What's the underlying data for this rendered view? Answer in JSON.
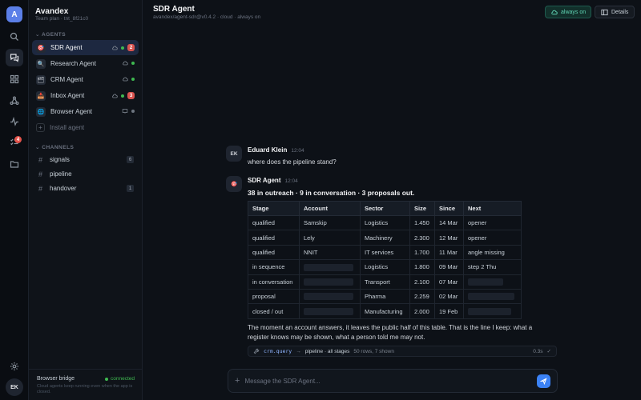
{
  "workspace": {
    "initial": "A",
    "name": "Avandex",
    "plan": "Team plan · tnt_8f21c0"
  },
  "rail": {
    "notification_count": "4",
    "user_initials": "EK"
  },
  "sidebar": {
    "agents_title": "AGENTS",
    "agents": [
      {
        "label": "SDR Agent",
        "icon": "dart-icon",
        "glyph": "🎯",
        "status": "green",
        "badge": "2",
        "host": "cloud"
      },
      {
        "label": "Research Agent",
        "icon": "magnifier-icon",
        "glyph": "🔍",
        "status": "green",
        "badge": "",
        "host": "cloud"
      },
      {
        "label": "CRM Agent",
        "icon": "card-file-icon",
        "glyph": "🗂",
        "status": "green",
        "badge": "",
        "host": "cloud"
      },
      {
        "label": "Inbox Agent",
        "icon": "inbox-icon",
        "glyph": "📥",
        "status": "green",
        "badge": "3",
        "host": "cloud"
      },
      {
        "label": "Browser Agent",
        "icon": "globe-icon",
        "glyph": "🌐",
        "status": "gray",
        "badge": "",
        "host": "monitor"
      }
    ],
    "install_label": "Install agent",
    "channels_title": "CHANNELS",
    "channels": [
      {
        "label": "signals",
        "count": "6"
      },
      {
        "label": "pipeline",
        "count": ""
      },
      {
        "label": "handover",
        "count": "1"
      }
    ],
    "bridge": {
      "title": "Browser bridge",
      "status": "connected",
      "description": "Cloud agents keep running even when the app is closed."
    }
  },
  "header": {
    "title": "SDR Agent",
    "subtitle": "avandex/agent-sdr@v0.4.2 · cloud · always on",
    "always_on_label": "always on",
    "details_label": "Details"
  },
  "messages": {
    "user": {
      "initials": "EK",
      "name": "Eduard Klein",
      "time": "12:04",
      "text": "where does the pipeline stand?"
    },
    "agent": {
      "name": "SDR Agent",
      "time": "12:04",
      "summary": "38 in outreach · 9 in conversation · 3 proposals out.",
      "table": {
        "headers": [
          "Stage",
          "Account",
          "Sector",
          "Size",
          "Since",
          "Next"
        ],
        "rows": [
          [
            "qualified",
            "Samskip",
            "Logistics",
            "1.450",
            "14 Mar",
            "opener"
          ],
          [
            "qualified",
            "Lely",
            "Machinery",
            "2.300",
            "12 Mar",
            "opener"
          ],
          [
            "qualified",
            "NNIT",
            "IT services",
            "1.700",
            "11 Mar",
            "angle missing"
          ],
          [
            "in sequence",
            "",
            "Logistics",
            "1.800",
            "09 Mar",
            "step 2 Thu"
          ],
          [
            "in conversation",
            "",
            "Transport",
            "2.100",
            "07 Mar",
            ""
          ],
          [
            "proposal",
            "",
            "Pharma",
            "2.259",
            "02 Mar",
            ""
          ],
          [
            "closed / out",
            "",
            "Manufacturing",
            "2.000",
            "19 Feb",
            ""
          ]
        ]
      },
      "footer_text": "The moment an account answers, it leaves the public half of this table. That is the line I keep: what a register knows may be shown, what a person told me may not.",
      "tool_call": {
        "name": "crm.query",
        "arrow": "→",
        "target": "pipeline · all stages",
        "result": "50 rows, 7 shown",
        "duration": "0.3s"
      }
    }
  },
  "composer": {
    "placeholder": "Message the SDR Agent..."
  },
  "colors": {
    "accent": "#3b82f6",
    "active_bg": "#1d2840",
    "status_green": "#3fb950",
    "badge_red": "#d9534f"
  }
}
